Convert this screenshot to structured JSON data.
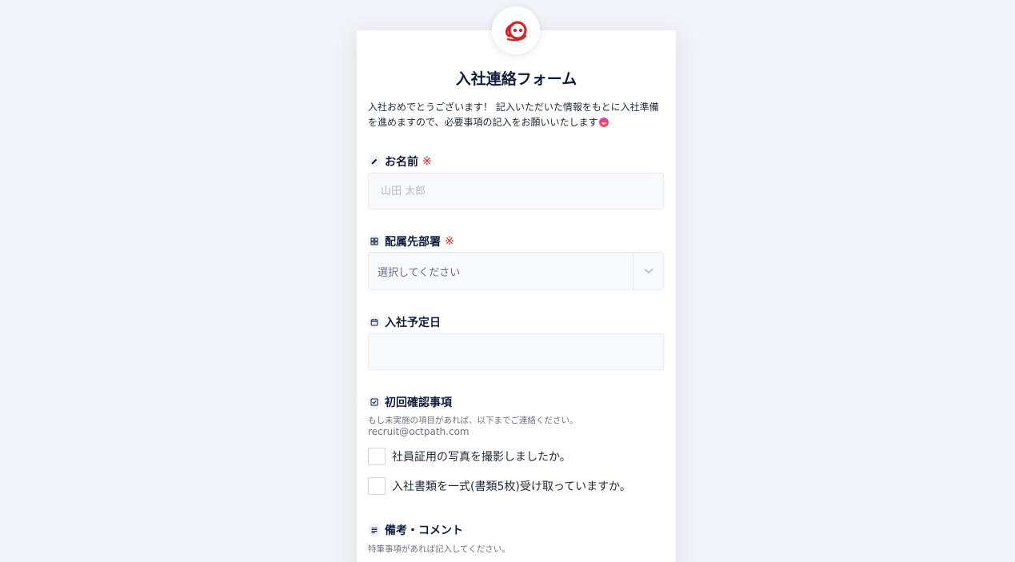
{
  "form": {
    "title": "入社連絡フォーム",
    "intro_line1": "入社おめでとうございます！ 記入いただいた情報をもとに入社準備",
    "intro_line2": "を進めますので、必要事項の記入をお願いいたします",
    "required_mark": "※",
    "name": {
      "label": "お名前",
      "placeholder": "山田 太郎",
      "value": "",
      "icon": "pencil-icon"
    },
    "department": {
      "label": "配属先部署",
      "selected": "選択してください",
      "icon": "grid-icon"
    },
    "start_date": {
      "label": "入社予定日",
      "value": "",
      "icon": "calendar-icon"
    },
    "initial_checks": {
      "label": "初回確認事項",
      "hint": "もし未実施の項目があれば、以下までご連絡ください。",
      "email": "recruit@octpath.com",
      "icon": "checkbox-icon",
      "items": [
        {
          "label": "社員証用の写真を撮影しましたか。",
          "checked": false
        },
        {
          "label": "入社書類を一式(書類5枚)受け取っていますか。",
          "checked": false
        }
      ]
    },
    "remarks": {
      "label": "備考・コメント",
      "hint": "特筆事項があれば記入してください。",
      "icon": "lines-icon"
    }
  },
  "colors": {
    "background": "#f1f4f8",
    "brand": "#d0262d",
    "heading": "#0f1d3a",
    "field_bg": "#f7f9fc"
  }
}
